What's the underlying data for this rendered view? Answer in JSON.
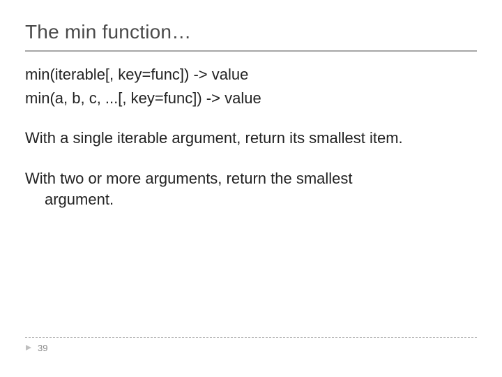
{
  "title": "The min function…",
  "sigs": {
    "line1": "min(iterable[, key=func]) -> value",
    "line2": "min(a, b, c, ...[, key=func]) -> value"
  },
  "paras": {
    "p1": "With a single iterable argument, return its smallest item.",
    "p2_a": "With two or more arguments, return the smallest",
    "p2_b": "argument."
  },
  "page_number": "39"
}
